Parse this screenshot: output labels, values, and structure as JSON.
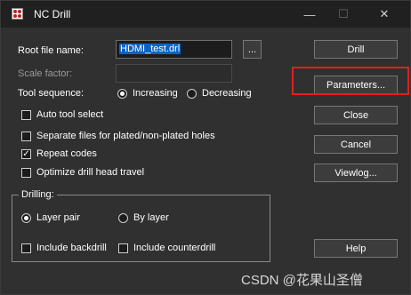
{
  "window": {
    "title": "NC Drill",
    "minimize_glyph": "—",
    "maximize_glyph": "☐",
    "close_glyph": "✕",
    "app_icon": "nc-drill-app-icon"
  },
  "form": {
    "root_file_label": "Root file name:",
    "root_file_value": "HDMI_test.drl",
    "browse_label": "...",
    "scale_factor_label": "Scale factor:",
    "scale_factor_value": "",
    "tool_sequence_label": "Tool sequence:",
    "increasing_label": "Increasing",
    "decreasing_label": "Decreasing",
    "tool_sequence_selected": "Increasing"
  },
  "options": {
    "auto_tool_select_label": "Auto tool select",
    "auto_tool_select_checked": false,
    "separate_files_label": "Separate files for plated/non-plated holes",
    "separate_files_checked": false,
    "repeat_codes_label": "Repeat codes",
    "repeat_codes_checked": true,
    "optimize_label": "Optimize drill head travel",
    "optimize_checked": false,
    "check_glyph": "✓"
  },
  "drilling": {
    "title": "Drilling:",
    "layer_pair_label": "Layer pair",
    "by_layer_label": "By layer",
    "selected": "Layer pair",
    "include_backdrill_label": "Include backdrill",
    "include_backdrill_checked": false,
    "include_counterdrill_label": "Include counterdrill",
    "include_counterdrill_checked": false
  },
  "buttons": {
    "drill": "Drill",
    "parameters": "Parameters...",
    "close": "Close",
    "cancel": "Cancel",
    "viewlog": "Viewlog...",
    "help": "Help"
  },
  "annotation": {
    "highlight_color": "#e02020"
  },
  "watermark": {
    "text": "CSDN @花果山圣僧"
  }
}
